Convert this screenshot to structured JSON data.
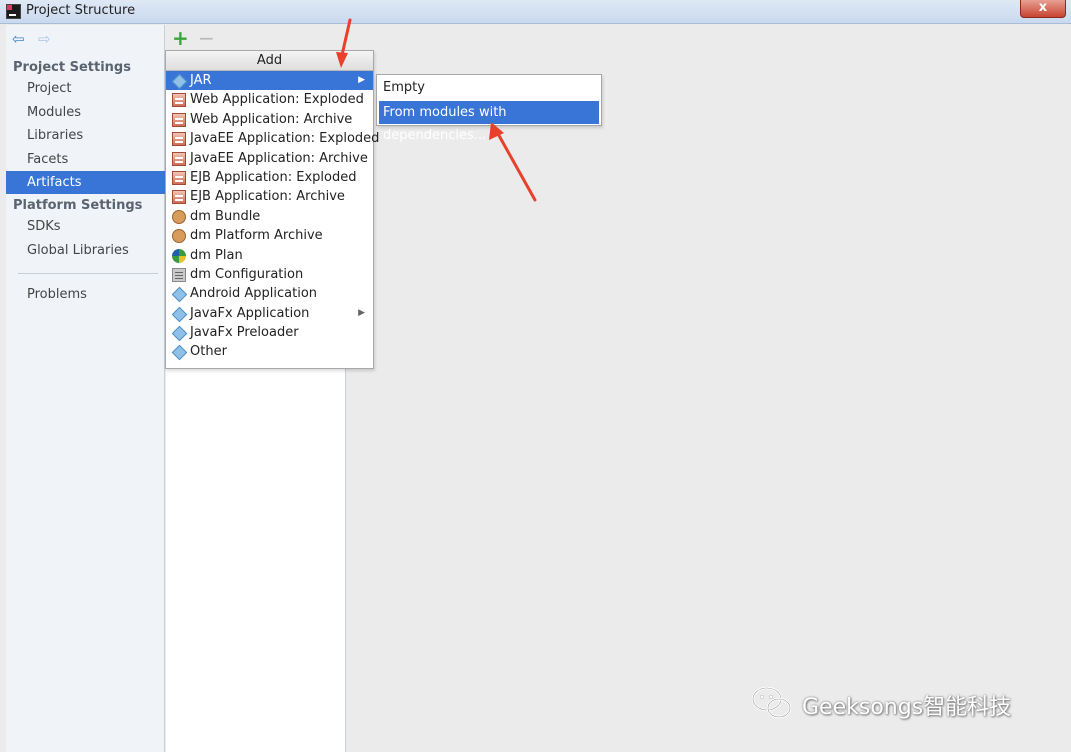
{
  "window": {
    "title": "Project Structure",
    "close_label": "x"
  },
  "sidebar": {
    "back_icon": "back-arrow-icon",
    "forward_icon": "forward-arrow-icon",
    "project_settings_header": "Project Settings",
    "project_items": [
      "Project",
      "Modules",
      "Libraries",
      "Facets",
      "Artifacts"
    ],
    "platform_settings_header": "Platform Settings",
    "platform_items": [
      "SDKs",
      "Global Libraries"
    ],
    "problems_label": "Problems",
    "selected": "Artifacts"
  },
  "toolbar": {
    "add_label": "+",
    "remove_label": "−"
  },
  "add_menu": {
    "header": "Add",
    "items": [
      {
        "label": "JAR",
        "icon": "jar-icon",
        "submenu": true,
        "selected": true
      },
      {
        "label": "Web Application: Exploded",
        "icon": "archive-icon"
      },
      {
        "label": "Web Application: Archive",
        "icon": "archive-icon"
      },
      {
        "label": "JavaEE Application: Exploded",
        "icon": "archive-icon"
      },
      {
        "label": "JavaEE Application: Archive",
        "icon": "archive-icon"
      },
      {
        "label": "EJB Application: Exploded",
        "icon": "archive-icon"
      },
      {
        "label": "EJB Application: Archive",
        "icon": "archive-icon"
      },
      {
        "label": "dm Bundle",
        "icon": "bundle-icon"
      },
      {
        "label": "dm Platform Archive",
        "icon": "bundle-icon"
      },
      {
        "label": "dm Plan",
        "icon": "plan-icon"
      },
      {
        "label": "dm Configuration",
        "icon": "config-icon"
      },
      {
        "label": "Android Application",
        "icon": "android-icon"
      },
      {
        "label": "JavaFx Application",
        "icon": "javafx-icon",
        "submenu": true
      },
      {
        "label": "JavaFx Preloader",
        "icon": "javafx-icon"
      },
      {
        "label": "Other",
        "icon": "other-icon"
      }
    ]
  },
  "jar_submenu": {
    "items": [
      "Empty",
      "From modules with dependencies..."
    ],
    "selected": "From modules with dependencies..."
  },
  "watermark": {
    "text": "Geeksongs智能科技"
  },
  "colors": {
    "selection": "#3875d7",
    "annotation": "#e8402a"
  }
}
